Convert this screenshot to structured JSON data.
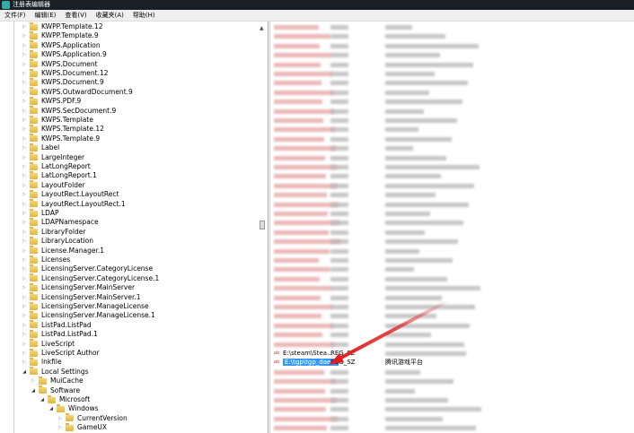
{
  "window": {
    "title": "注册表编辑器"
  },
  "menu": [
    "文件(F)",
    "编辑(E)",
    "查看(V)",
    "收藏夹(A)",
    "帮助(H)"
  ],
  "tree": [
    {
      "label": "KWPP.Template.12",
      "depth": 0,
      "state": "collapsed"
    },
    {
      "label": "KWPP.Template.9",
      "depth": 0,
      "state": "collapsed"
    },
    {
      "label": "KWPS.Application",
      "depth": 0,
      "state": "collapsed"
    },
    {
      "label": "KWPS.Application.9",
      "depth": 0,
      "state": "collapsed"
    },
    {
      "label": "KWPS.Document",
      "depth": 0,
      "state": "collapsed"
    },
    {
      "label": "KWPS.Document.12",
      "depth": 0,
      "state": "collapsed"
    },
    {
      "label": "KWPS.Document.9",
      "depth": 0,
      "state": "collapsed"
    },
    {
      "label": "KWPS.OutwardDocument.9",
      "depth": 0,
      "state": "collapsed"
    },
    {
      "label": "KWPS.PDF.9",
      "depth": 0,
      "state": "collapsed"
    },
    {
      "label": "KWPS.SecDocument.9",
      "depth": 0,
      "state": "collapsed"
    },
    {
      "label": "KWPS.Template",
      "depth": 0,
      "state": "collapsed"
    },
    {
      "label": "KWPS.Template.12",
      "depth": 0,
      "state": "collapsed"
    },
    {
      "label": "KWPS.Template.9",
      "depth": 0,
      "state": "collapsed"
    },
    {
      "label": "Label",
      "depth": 0,
      "state": "collapsed"
    },
    {
      "label": "LargeInteger",
      "depth": 0,
      "state": "collapsed"
    },
    {
      "label": "LatLongReport",
      "depth": 0,
      "state": "collapsed"
    },
    {
      "label": "LatLongReport.1",
      "depth": 0,
      "state": "collapsed"
    },
    {
      "label": "LayoutFolder",
      "depth": 0,
      "state": "collapsed"
    },
    {
      "label": "LayoutRect.LayoutRect",
      "depth": 0,
      "state": "collapsed"
    },
    {
      "label": "LayoutRect.LayoutRect.1",
      "depth": 0,
      "state": "collapsed"
    },
    {
      "label": "LDAP",
      "depth": 0,
      "state": "collapsed"
    },
    {
      "label": "LDAPNamespace",
      "depth": 0,
      "state": "collapsed"
    },
    {
      "label": "LibraryFolder",
      "depth": 0,
      "state": "collapsed"
    },
    {
      "label": "LibraryLocation",
      "depth": 0,
      "state": "collapsed"
    },
    {
      "label": "License.Manager.1",
      "depth": 0,
      "state": "collapsed"
    },
    {
      "label": "Licenses",
      "depth": 0,
      "state": "collapsed"
    },
    {
      "label": "LicensingServer.CategoryLicense",
      "depth": 0,
      "state": "collapsed"
    },
    {
      "label": "LicensingServer.CategoryLicense.1",
      "depth": 0,
      "state": "collapsed"
    },
    {
      "label": "LicensingServer.MainServer",
      "depth": 0,
      "state": "collapsed"
    },
    {
      "label": "LicensingServer.MainServer.1",
      "depth": 0,
      "state": "collapsed"
    },
    {
      "label": "LicensingServer.ManageLicense",
      "depth": 0,
      "state": "collapsed"
    },
    {
      "label": "LicensingServer.ManageLicense.1",
      "depth": 0,
      "state": "collapsed"
    },
    {
      "label": "ListPad.ListPad",
      "depth": 0,
      "state": "collapsed"
    },
    {
      "label": "ListPad.ListPad.1",
      "depth": 0,
      "state": "collapsed"
    },
    {
      "label": "LiveScript",
      "depth": 0,
      "state": "collapsed"
    },
    {
      "label": "LiveScript Author",
      "depth": 0,
      "state": "collapsed"
    },
    {
      "label": "lnkfile",
      "depth": 0,
      "state": "collapsed"
    },
    {
      "label": "Local Settings",
      "depth": 0,
      "state": "expanded"
    },
    {
      "label": "MuiCache",
      "depth": 1,
      "state": "collapsed"
    },
    {
      "label": "Software",
      "depth": 1,
      "state": "expanded"
    },
    {
      "label": "Microsoft",
      "depth": 2,
      "state": "expanded"
    },
    {
      "label": "Windows",
      "depth": 3,
      "state": "expanded"
    },
    {
      "label": "CurrentVersion",
      "depth": 4,
      "state": "collapsed"
    },
    {
      "label": "GameUX",
      "depth": 4,
      "state": "collapsed"
    }
  ],
  "values": [
    {
      "name": "E:\\steam\\Stea...",
      "type": "REG_SZ",
      "data": "",
      "row": 23,
      "selected": false
    },
    {
      "name": "E:\\tgp\\tgp_dae...",
      "type": "REG_SZ",
      "data": "腾讯游戏平台",
      "row": 24,
      "selected": true
    }
  ],
  "colors": {
    "selection": "#3399ff",
    "arrow": "#e02020"
  }
}
